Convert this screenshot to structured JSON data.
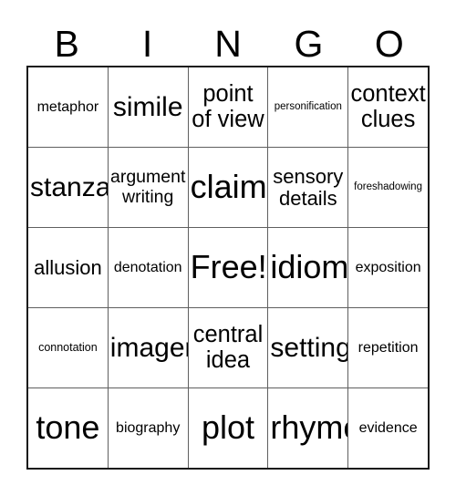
{
  "card": {
    "title": "BINGO",
    "header_letters": [
      "B",
      "I",
      "N",
      "G",
      "O"
    ],
    "free_space_label": "Free!",
    "border_color": "#1a1a1a",
    "grid_line_color": "#5f5f5f",
    "background_color": "#ffffff",
    "text_color": "#000000",
    "rows": 5,
    "columns": 5
  },
  "cells": [
    [
      {
        "label": "metaphor",
        "size": "s"
      },
      {
        "label": "simile",
        "size": "xl"
      },
      {
        "label": "point\nof view",
        "size": "l"
      },
      {
        "label": "personification",
        "size": "xxs"
      },
      {
        "label": "context\nclues",
        "size": "l"
      }
    ],
    [
      {
        "label": "stanza",
        "size": "xl"
      },
      {
        "label": "argument\nwriting",
        "size": "m"
      },
      {
        "label": "claim",
        "size": "xxl"
      },
      {
        "label": "sensory\ndetails",
        "size": "ml"
      },
      {
        "label": "foreshadowing",
        "size": "xxs"
      }
    ],
    [
      {
        "label": "allusion",
        "size": "ml"
      },
      {
        "label": "denotation",
        "size": "s"
      },
      {
        "label": "Free!",
        "size": "xxl"
      },
      {
        "label": "idiom",
        "size": "xxl"
      },
      {
        "label": "exposition",
        "size": "s"
      }
    ],
    [
      {
        "label": "connotation",
        "size": "xs"
      },
      {
        "label": "imagery",
        "size": "xl"
      },
      {
        "label": "central\nidea",
        "size": "l"
      },
      {
        "label": "setting",
        "size": "xl"
      },
      {
        "label": "repetition",
        "size": "s"
      }
    ],
    [
      {
        "label": "tone",
        "size": "xxl"
      },
      {
        "label": "biography",
        "size": "s"
      },
      {
        "label": "plot",
        "size": "xxl"
      },
      {
        "label": "rhyme",
        "size": "xxl"
      },
      {
        "label": "evidence",
        "size": "s"
      }
    ]
  ]
}
